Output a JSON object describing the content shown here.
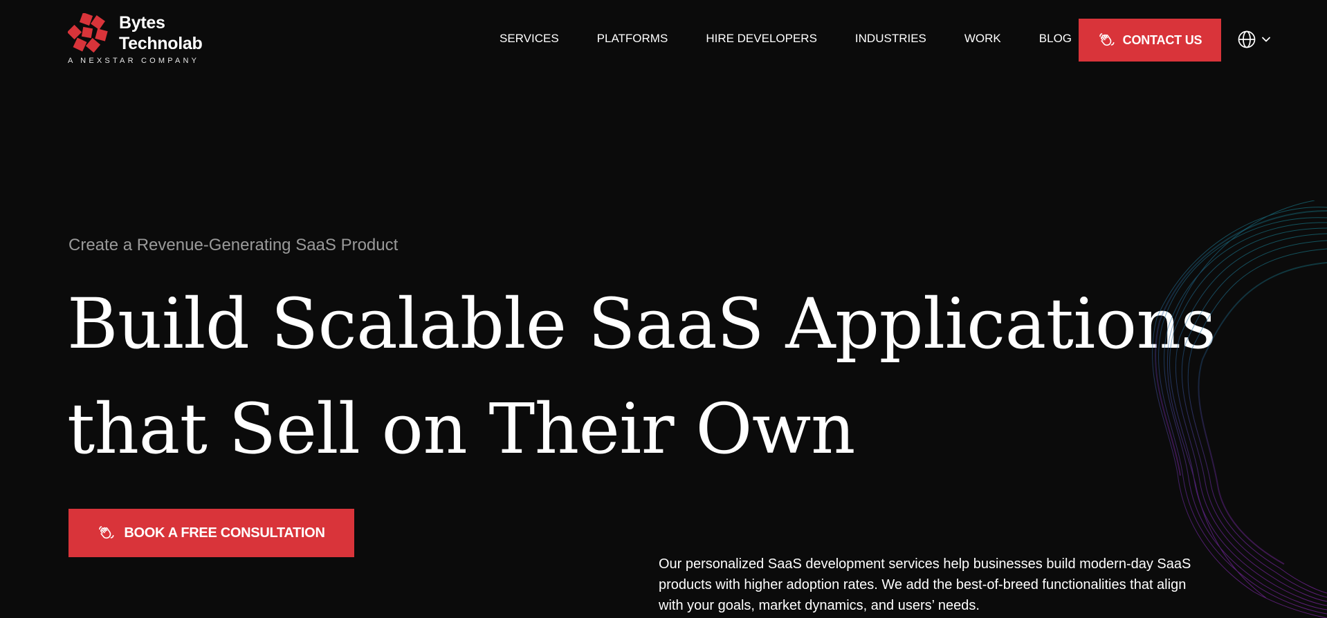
{
  "logo": {
    "name_line1": "Bytes",
    "name_line2": "Technolab",
    "tagline": "A NEXSTAR COMPANY",
    "icon": "bytes-technolab-logo-mark"
  },
  "nav": {
    "items": [
      {
        "label": "SERVICES"
      },
      {
        "label": "PLATFORMS"
      },
      {
        "label": "HIRE DEVELOPERS"
      },
      {
        "label": "INDUSTRIES"
      },
      {
        "label": "WORK"
      },
      {
        "label": "BLOG"
      }
    ],
    "contact_label": "CONTACT US",
    "language_icon": "globe-icon"
  },
  "hero": {
    "eyebrow": "Create a Revenue-Generating SaaS Product",
    "headline_line1": "Build Scalable SaaS Applications",
    "headline_line2": "that Sell on Their Own",
    "cta_label": "BOOK A FREE CONSULTATION",
    "description": "Our personalized SaaS development services help businesses build modern-day SaaS products with higher adoption rates. We add the best-of-breed functionalities that align with your goals, market dynamics, and users’ needs."
  },
  "colors": {
    "background": "#0b0b0b",
    "accent": "#d9343a",
    "text": "#ffffff",
    "muted_text": "#9a9a9a",
    "art_teal": "#1a8ea0",
    "art_purple": "#a02fd0"
  }
}
